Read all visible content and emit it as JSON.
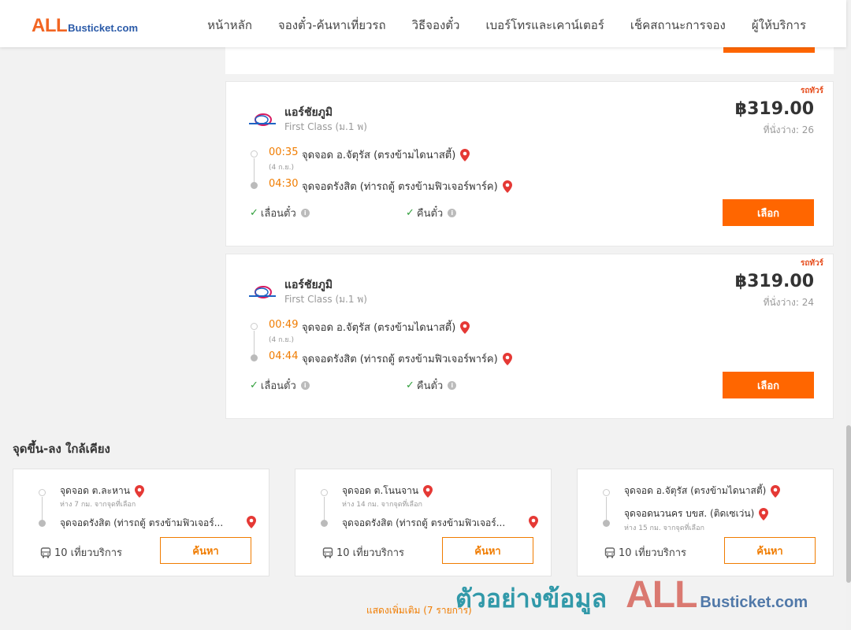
{
  "header": {
    "logo_main": "ALL",
    "logo_rest": "Busticket.com",
    "nav": [
      "หน้าหลัก",
      "จองตั๋ว-ค้นหาเที่ยวรถ",
      "วิธีจองตั๋ว",
      "เบอร์โทรและเคาน์เตอร์",
      "เช็คสถานะการจอง",
      "ผู้ให้บริการ"
    ]
  },
  "trips": [
    {
      "tag": "รถทัวร์",
      "operator": "แอร์ชัยภูมิ",
      "bus_class": "First Class (ม.1 พ)",
      "price": "฿319.00",
      "seats": "ที่นั่งว่าง: 26",
      "dep_time": "00:35",
      "dep_date": "(4 ก.ย.)",
      "dep_place": "จุดจอด อ.จัตุรัส (ตรงข้ามไดนาสตี้)",
      "arr_time": "04:30",
      "arr_place": "จุดจอดรังสิต (ท่ารถตู้ ตรงข้ามฟิวเจอร์พาร์ค)",
      "feature_1": "เลื่อนตั๋ว",
      "feature_2": "คืนตั๋ว",
      "button": "เลือก"
    },
    {
      "tag": "รถทัวร์",
      "operator": "แอร์ชัยภูมิ",
      "bus_class": "First Class (ม.1 พ)",
      "price": "฿319.00",
      "seats": "ที่นั่งว่าง: 24",
      "dep_time": "00:49",
      "dep_date": "(4 ก.ย.)",
      "dep_place": "จุดจอด อ.จัตุรัส (ตรงข้ามไดนาสตี้)",
      "arr_time": "04:44",
      "arr_place": "จุดจอดรังสิต (ท่ารถตู้ ตรงข้ามฟิวเจอร์พาร์ค)",
      "feature_1": "เลื่อนตั๋ว",
      "feature_2": "คืนตั๋ว",
      "button": "เลือก"
    }
  ],
  "nearby": {
    "title": "จุดขึ้น-ลง ใกล้เคียง",
    "cards": [
      {
        "from": "จุดจอด ต.ละหาน",
        "from_sub": "ห่าง 7 กม. จากจุดที่เลือก",
        "to": "จุดจอดรังสิต (ท่ารถตู้ ตรงข้ามฟิวเจอร์...",
        "to_sub": "",
        "trips": "10 เที่ยวบริการ",
        "button": "ค้นหา"
      },
      {
        "from": "จุดจอด ต.โนนจาน",
        "from_sub": "ห่าง 14 กม. จากจุดที่เลือก",
        "to": "จุดจอดรังสิต (ท่ารถตู้ ตรงข้ามฟิวเจอร์...",
        "to_sub": "",
        "trips": "10 เที่ยวบริการ",
        "button": "ค้นหา"
      },
      {
        "from": "จุดจอด อ.จัตุรัส (ตรงข้ามไดนาสตี้)",
        "from_sub": "",
        "to": "จุดจอดนวนคร บขส. (ติดเซเว่น)",
        "to_sub": "ห่าง 15 กม. จากจุดที่เลือก",
        "trips": "10 เที่ยวบริการ",
        "button": "ค้นหา"
      }
    ]
  },
  "more_link": "แสดงเพิ่มเติม (7 รายการ)",
  "watermark": {
    "text": "ตัวอย่างข้อมูล",
    "logo_main": "ALL",
    "logo_rest": "Busticket.com"
  },
  "colors": {
    "accent": "#ff6600",
    "time": "#f07c00",
    "check": "#2e9e3a",
    "pin": "#e53935"
  }
}
